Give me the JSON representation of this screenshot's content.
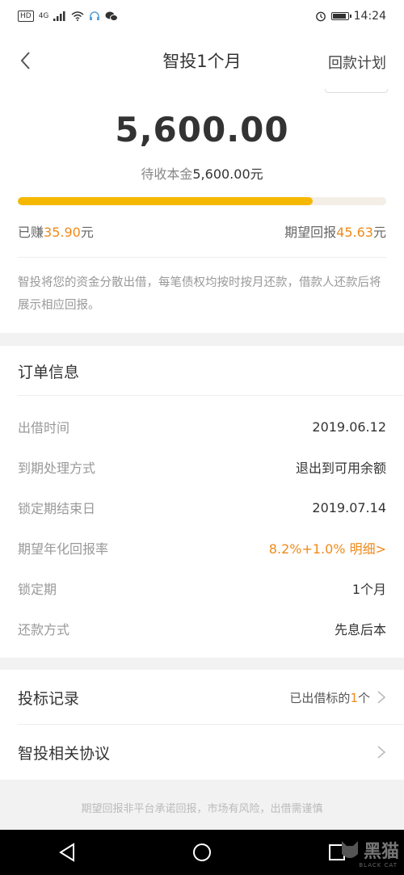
{
  "status_bar": {
    "left_badge": "HD",
    "signal_label": "4G",
    "time": "14:24"
  },
  "nav": {
    "title": "智投1个月",
    "right_action": "回款计划"
  },
  "summary": {
    "amount": "5,600.00",
    "principal_label": "待收本金",
    "principal_value": "5,600.00元",
    "progress": 0.8,
    "earned_label": "已赚",
    "earned_value": "35.90",
    "earned_unit": "元",
    "expected_label": "期望回报",
    "expected_value": "45.63",
    "expected_unit": "元",
    "description": "智投将您的资金分散出借，每笔债权均按时按月还款，借款人还款后将展示相应回报。"
  },
  "order": {
    "title": "订单信息",
    "rows": [
      {
        "label": "出借时间",
        "value": "2019.06.12"
      },
      {
        "label": "到期处理方式",
        "value": "退出到可用余额"
      },
      {
        "label": "锁定期结束日",
        "value": "2019.07.14"
      },
      {
        "label": "期望年化回报率",
        "value": "8.2%+1.0% 明细>"
      },
      {
        "label": "锁定期",
        "value": "1个月"
      },
      {
        "label": "还款方式",
        "value": "先息后本"
      }
    ]
  },
  "links": {
    "bid_records_label": "投标记录",
    "bid_records_value_prefix": "已出借标的",
    "bid_records_count": "1",
    "bid_records_value_suffix": "个",
    "agreement_label": "智投相关协议"
  },
  "footer_note": "期望回报非平台承诺回报，市场有风险，出借需谨慎",
  "watermark": {
    "text": "黑猫",
    "sub": "BLACK CAT"
  },
  "colors": {
    "accent": "#ef8a1a",
    "progress": "#f5b800",
    "progress_track": "#f3eee6"
  }
}
